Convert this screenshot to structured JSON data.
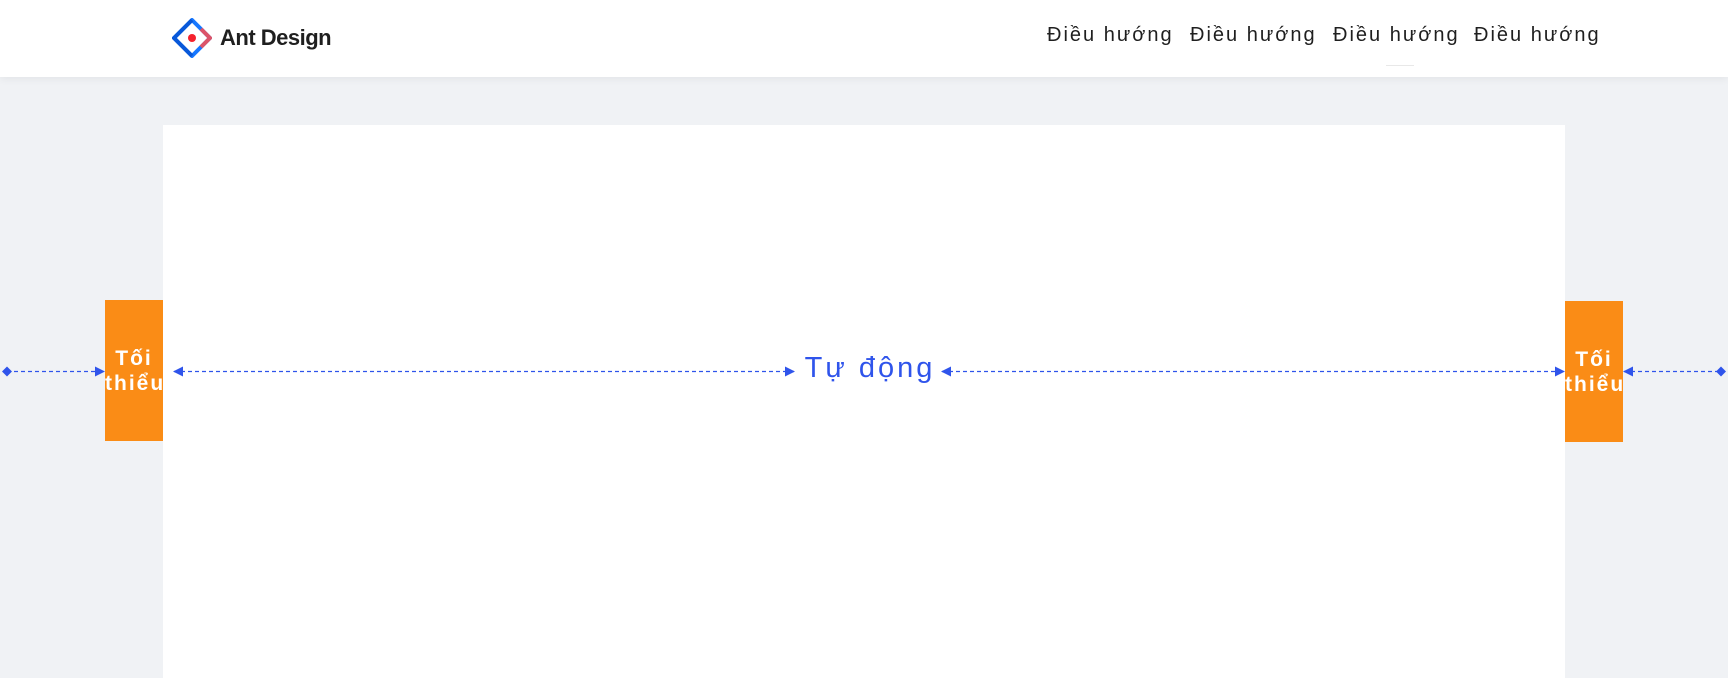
{
  "header": {
    "logo_text": "Ant Design",
    "nav_items": [
      {
        "label": "Điều hướng"
      },
      {
        "label": "Điều hướng"
      },
      {
        "label": "Điều hướng"
      },
      {
        "label": "Điều hướng"
      }
    ]
  },
  "diagram": {
    "left_box": {
      "line1": "Tối",
      "line2": "thiểu"
    },
    "right_box": {
      "line1": "Tối",
      "line2": "thiểu"
    },
    "center_label": "Tự động",
    "colors": {
      "box": "#fa8c16",
      "arrow": "#2f54eb",
      "content_bg": "#ffffff",
      "page_bg": "#f0f2f5"
    }
  }
}
